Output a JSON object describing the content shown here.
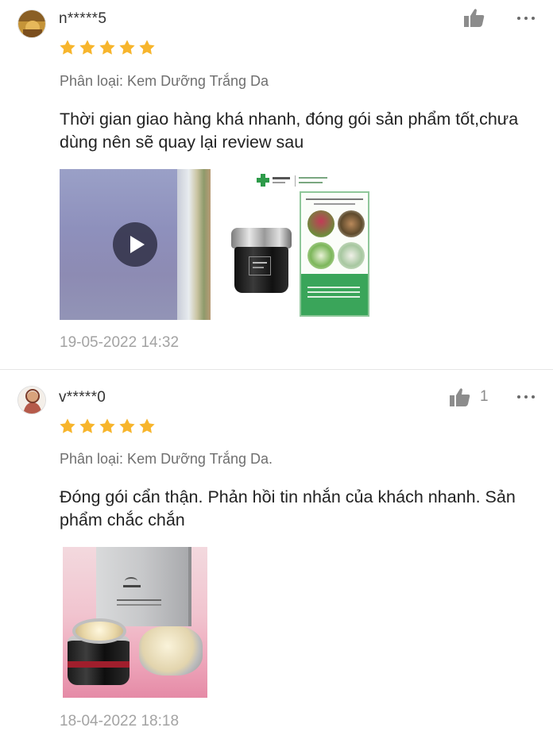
{
  "reviews": [
    {
      "username": "n*****5",
      "avatar_icon": "user-avatar-icon",
      "rating": 5,
      "like_count": "",
      "variant": "Phân loại: Kem Dưỡng Trắng Da",
      "comment": "Thời gian giao hàng khá nhanh, đóng gói sản phẩm tốt,chưa dùng nên sẽ quay lại review sau",
      "media": [
        "video",
        "photo"
      ],
      "timestamp": "19-05-2022 14:32"
    },
    {
      "username": "v*****0",
      "avatar_icon": "user-avatar-icon",
      "rating": 5,
      "like_count": "1",
      "variant": "Phân loại: Kem Dưỡng Trắng Da.",
      "comment": "Đóng gói cẩn thận. Phản hồi tin nhắn của khách nhanh. Sản phẩm chắc chắn",
      "media": [
        "photo"
      ],
      "timestamp": "18-04-2022 18:18"
    }
  ],
  "icons": {
    "like": "thumbs-up-icon",
    "more": "more-options-icon",
    "star": "star-icon",
    "play": "play-icon"
  },
  "colors": {
    "star": "#f7b52c",
    "like_icon": "#8c8c8c",
    "muted_text": "#a3a3a3",
    "variant_text": "#6f6f6f"
  }
}
